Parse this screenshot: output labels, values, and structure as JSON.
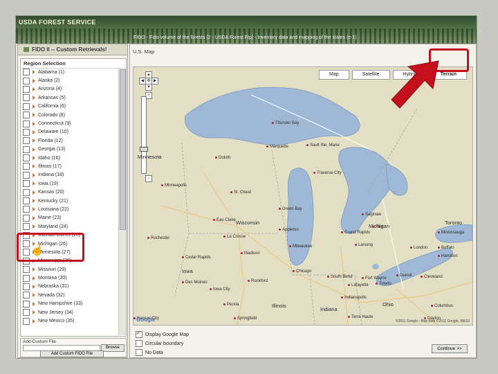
{
  "brand": "USDA FOREST SERVICE",
  "top_title": "FIDO - Fido volume of the forests (2 - USDA Forest Ftp) - Inventory data and mapping of the states (c-1)",
  "left_panel": {
    "title": "FIDO II -- Custom Retrievals!",
    "region_title": "Region Selection",
    "states": [
      "Alabama (1)",
      "Alaska (2)",
      "Arizona (4)",
      "Arkansas (5)",
      "California (6)",
      "Colorado (8)",
      "Connecticut (9)",
      "Delaware (10)",
      "Florida (12)",
      "Georgia (13)",
      "Idaho (16)",
      "Illinois (17)",
      "Indiana (18)",
      "Iowa (19)",
      "Kansas (20)",
      "Kentucky (21)",
      "Louisiana (22)",
      "Maine (23)",
      "Maryland (24)",
      "Massachusetts (25)",
      "Michigan (26)",
      "Minnesota (27)",
      "Mississippi (28)",
      "Missouri (29)",
      "Montana (30)",
      "Nebraska (31)",
      "Nevada (32)",
      "New Hampshire (33)",
      "New Jersey (34)",
      "New Mexico (35)"
    ],
    "add_label": "Add Custom File",
    "browse_label": "Browse",
    "add_button": "Add Custom FIDO File"
  },
  "right_panel": {
    "title": "U.S. Map",
    "map_types": [
      "Map",
      "Satellite",
      "Hybrid",
      "Terrain"
    ],
    "selected_map_type": "Terrain",
    "google": "Google",
    "copyright": "©2011 Google - Map data ©2011 Google, INEGI",
    "options": [
      "Display Google Map",
      "Circular boundary"
    ],
    "no_data": "No Data",
    "continue_button": "Continue >>"
  },
  "map_labels": {
    "big": [
      "Minnesota",
      "Wisconsin",
      "Iowa",
      "Illinois",
      "Indiana",
      "Ohio",
      "Michigan",
      "Toronto"
    ],
    "cities": [
      "Thunder Bay",
      "Duluth",
      "Minneapolis",
      "St. Cloud",
      "Green Bay",
      "Milwaukee",
      "Chicago",
      "Madison",
      "Rockford",
      "Des Moines",
      "Iowa City",
      "Peoria",
      "Springfield",
      "Indianapolis",
      "Detroit",
      "Lansing",
      "Grand Rapids",
      "Toledo",
      "Cleveland",
      "Columbus",
      "Fort Wayne",
      "South Bend",
      "Flint",
      "Saginaw",
      "London",
      "Hamilton",
      "Mississauga",
      "Buffalo",
      "Eau Claire",
      "La Crosse",
      "Appleton",
      "Kansas City",
      "Sault Ste. Marie",
      "Marquette",
      "Traverse City",
      "Dayton",
      "Rochester",
      "Cedar Rapids",
      "Terre Haute",
      "Lafayette"
    ]
  },
  "colors": {
    "highlight": "#c40f1d",
    "lake": "#9fb8d6",
    "land": "#e7e3cd",
    "banner": "#3d5a38"
  }
}
